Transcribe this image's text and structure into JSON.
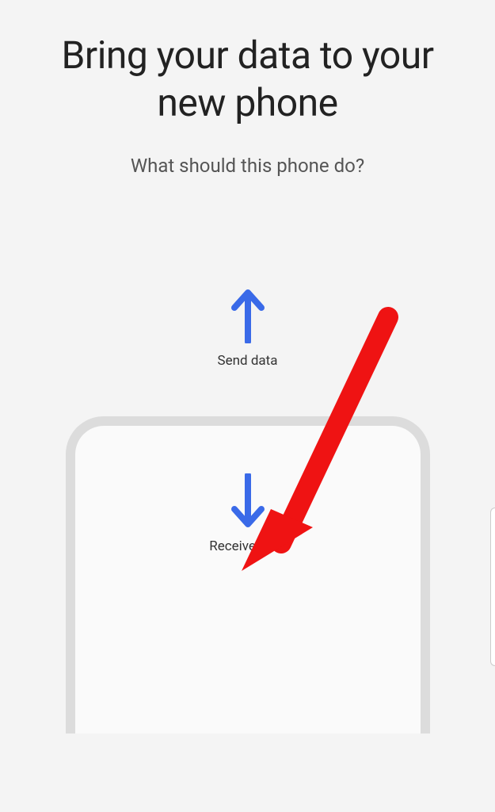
{
  "header": {
    "title": "Bring your data to your new phone",
    "subtitle": "What should this phone do?"
  },
  "options": {
    "send": {
      "label": "Send data",
      "icon": "arrow-up-icon"
    },
    "receive": {
      "label": "Receive data",
      "icon": "arrow-down-icon"
    }
  },
  "colors": {
    "arrow_blue": "#3a6ae8",
    "annotation_red": "#ef1313"
  },
  "annotation": {
    "type": "arrow",
    "points_to": "receive-data-button"
  }
}
